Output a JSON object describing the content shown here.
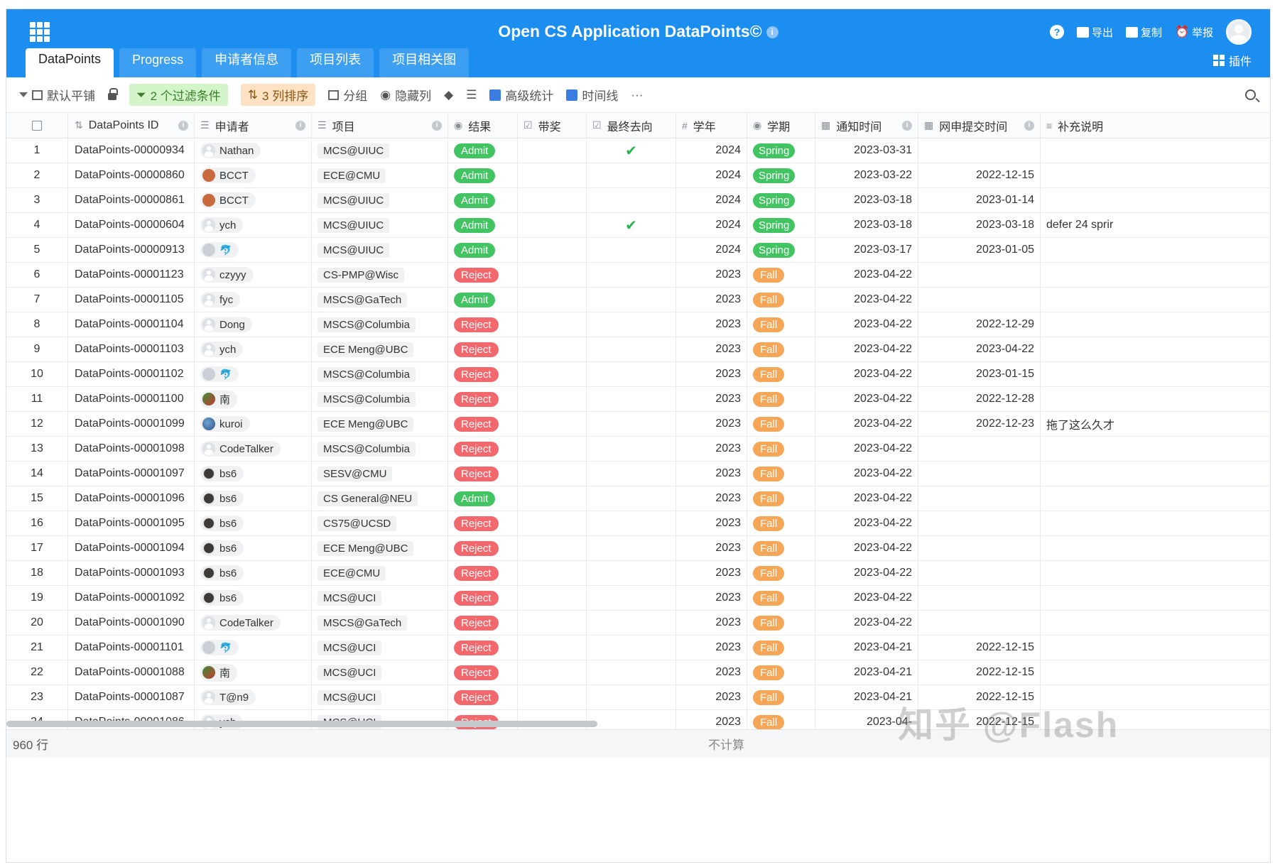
{
  "header": {
    "title": "Open CS Application DataPoints©",
    "actions": {
      "export": "导出",
      "copy": "复制",
      "report": "举报"
    },
    "plugins": "插件"
  },
  "tabs": [
    "DataPoints",
    "Progress",
    "申请者信息",
    "项目列表",
    "项目相关图"
  ],
  "toolbar": {
    "view": "默认平铺",
    "filter": "2 个过滤条件",
    "sort": "3 列排序",
    "group": "分组",
    "hide": "隐藏列",
    "stats": "高级统计",
    "timeline": "时间线",
    "more": "···"
  },
  "columns": [
    "DataPoints ID",
    "申请者",
    "项目",
    "结果",
    "带奖",
    "最终去向",
    "学年",
    "学期",
    "通知时间",
    "网申提交时间",
    "补充说明"
  ],
  "rows": [
    {
      "n": "1",
      "id": "DataPoints-00000934",
      "user": "Nathan",
      "av": "default",
      "proj": "MCS@UIUC",
      "result": "Admit",
      "final": true,
      "year": "2024",
      "term": "Spring",
      "notify": "2023-03-31",
      "submit": "",
      "note": ""
    },
    {
      "n": "2",
      "id": "DataPoints-00000860",
      "user": "BCCT",
      "av": "brown",
      "proj": "ECE@CMU",
      "result": "Admit",
      "final": false,
      "year": "2024",
      "term": "Spring",
      "notify": "2023-03-22",
      "submit": "2022-12-15",
      "note": ""
    },
    {
      "n": "3",
      "id": "DataPoints-00000861",
      "user": "BCCT",
      "av": "brown",
      "proj": "MCS@UIUC",
      "result": "Admit",
      "final": false,
      "year": "2024",
      "term": "Spring",
      "notify": "2023-03-18",
      "submit": "2023-01-14",
      "note": ""
    },
    {
      "n": "4",
      "id": "DataPoints-00000604",
      "user": "ych",
      "av": "default",
      "proj": "MCS@UIUC",
      "result": "Admit",
      "final": true,
      "year": "2024",
      "term": "Spring",
      "notify": "2023-03-18",
      "submit": "2023-03-18",
      "note": "defer 24 sprir"
    },
    {
      "n": "5",
      "id": "DataPoints-00000913",
      "user": "🐬",
      "av": "cat",
      "proj": "MCS@UIUC",
      "result": "Admit",
      "final": false,
      "year": "2024",
      "term": "Spring",
      "notify": "2023-03-17",
      "submit": "2023-01-05",
      "note": ""
    },
    {
      "n": "6",
      "id": "DataPoints-00001123",
      "user": "czyyy",
      "av": "default",
      "proj": "CS-PMP@Wisc",
      "result": "Reject",
      "final": false,
      "year": "2023",
      "term": "Fall",
      "notify": "2023-04-22",
      "submit": "",
      "note": ""
    },
    {
      "n": "7",
      "id": "DataPoints-00001105",
      "user": "fyc",
      "av": "default",
      "proj": "MSCS@GaTech",
      "result": "Admit",
      "final": false,
      "year": "2023",
      "term": "Fall",
      "notify": "2023-04-22",
      "submit": "",
      "note": ""
    },
    {
      "n": "8",
      "id": "DataPoints-00001104",
      "user": "Dong",
      "av": "default",
      "proj": "MSCS@Columbia",
      "result": "Reject",
      "final": false,
      "year": "2023",
      "term": "Fall",
      "notify": "2023-04-22",
      "submit": "2022-12-29",
      "note": ""
    },
    {
      "n": "9",
      "id": "DataPoints-00001103",
      "user": "ych",
      "av": "default",
      "proj": "ECE Meng@UBC",
      "result": "Reject",
      "final": false,
      "year": "2023",
      "term": "Fall",
      "notify": "2023-04-22",
      "submit": "2023-04-22",
      "note": ""
    },
    {
      "n": "10",
      "id": "DataPoints-00001102",
      "user": "🐬",
      "av": "cat",
      "proj": "MSCS@Columbia",
      "result": "Reject",
      "final": false,
      "year": "2023",
      "term": "Fall",
      "notify": "2023-04-22",
      "submit": "2023-01-15",
      "note": ""
    },
    {
      "n": "11",
      "id": "DataPoints-00001100",
      "user": "南",
      "av": "leaf",
      "proj": "MSCS@Columbia",
      "result": "Reject",
      "final": false,
      "year": "2023",
      "term": "Fall",
      "notify": "2023-04-22",
      "submit": "2022-12-28",
      "note": ""
    },
    {
      "n": "12",
      "id": "DataPoints-00001099",
      "user": "kuroi",
      "av": "globe",
      "proj": "ECE Meng@UBC",
      "result": "Reject",
      "final": false,
      "year": "2023",
      "term": "Fall",
      "notify": "2023-04-22",
      "submit": "2022-12-23",
      "note": "拖了这么久才"
    },
    {
      "n": "13",
      "id": "DataPoints-00001098",
      "user": "CodeTalker",
      "av": "default",
      "proj": "MSCS@Columbia",
      "result": "Reject",
      "final": false,
      "year": "2023",
      "term": "Fall",
      "notify": "2023-04-22",
      "submit": "",
      "note": ""
    },
    {
      "n": "14",
      "id": "DataPoints-00001097",
      "user": "bs6",
      "av": "dark",
      "proj": "SESV@CMU",
      "result": "Reject",
      "final": false,
      "year": "2023",
      "term": "Fall",
      "notify": "2023-04-22",
      "submit": "",
      "note": ""
    },
    {
      "n": "15",
      "id": "DataPoints-00001096",
      "user": "bs6",
      "av": "dark",
      "proj": "CS General@NEU",
      "result": "Admit",
      "final": false,
      "year": "2023",
      "term": "Fall",
      "notify": "2023-04-22",
      "submit": "",
      "note": ""
    },
    {
      "n": "16",
      "id": "DataPoints-00001095",
      "user": "bs6",
      "av": "dark",
      "proj": "CS75@UCSD",
      "result": "Reject",
      "final": false,
      "year": "2023",
      "term": "Fall",
      "notify": "2023-04-22",
      "submit": "",
      "note": ""
    },
    {
      "n": "17",
      "id": "DataPoints-00001094",
      "user": "bs6",
      "av": "dark",
      "proj": "ECE Meng@UBC",
      "result": "Reject",
      "final": false,
      "year": "2023",
      "term": "Fall",
      "notify": "2023-04-22",
      "submit": "",
      "note": ""
    },
    {
      "n": "18",
      "id": "DataPoints-00001093",
      "user": "bs6",
      "av": "dark",
      "proj": "ECE@CMU",
      "result": "Reject",
      "final": false,
      "year": "2023",
      "term": "Fall",
      "notify": "2023-04-22",
      "submit": "",
      "note": ""
    },
    {
      "n": "19",
      "id": "DataPoints-00001092",
      "user": "bs6",
      "av": "dark",
      "proj": "MCS@UCI",
      "result": "Reject",
      "final": false,
      "year": "2023",
      "term": "Fall",
      "notify": "2023-04-22",
      "submit": "",
      "note": ""
    },
    {
      "n": "20",
      "id": "DataPoints-00001090",
      "user": "CodeTalker",
      "av": "default",
      "proj": "MSCS@GaTech",
      "result": "Reject",
      "final": false,
      "year": "2023",
      "term": "Fall",
      "notify": "2023-04-22",
      "submit": "",
      "note": ""
    },
    {
      "n": "21",
      "id": "DataPoints-00001101",
      "user": "🐬",
      "av": "cat",
      "proj": "MCS@UCI",
      "result": "Reject",
      "final": false,
      "year": "2023",
      "term": "Fall",
      "notify": "2023-04-21",
      "submit": "2022-12-15",
      "note": ""
    },
    {
      "n": "22",
      "id": "DataPoints-00001088",
      "user": "南",
      "av": "leaf",
      "proj": "MCS@UCI",
      "result": "Reject",
      "final": false,
      "year": "2023",
      "term": "Fall",
      "notify": "2023-04-21",
      "submit": "2022-12-15",
      "note": ""
    },
    {
      "n": "23",
      "id": "DataPoints-00001087",
      "user": "T@n9",
      "av": "default",
      "proj": "MCS@UCI",
      "result": "Reject",
      "final": false,
      "year": "2023",
      "term": "Fall",
      "notify": "2023-04-21",
      "submit": "2022-12-15",
      "note": ""
    },
    {
      "n": "24",
      "id": "DataPoints-00001086",
      "user": "ych",
      "av": "default",
      "proj": "MCS@UCI",
      "result": "Reject",
      "final": false,
      "year": "2023",
      "term": "Fall",
      "notify": "2023-04-",
      "submit": "2022-12-15",
      "note": ""
    }
  ],
  "footer": {
    "count": "960 行",
    "calc": "不计算"
  },
  "watermark": "知乎 @Flash",
  "colors": {
    "brand": "#1c8ef0",
    "admit": "#43c463",
    "reject": "#f2686d",
    "fall": "#f5a656"
  }
}
